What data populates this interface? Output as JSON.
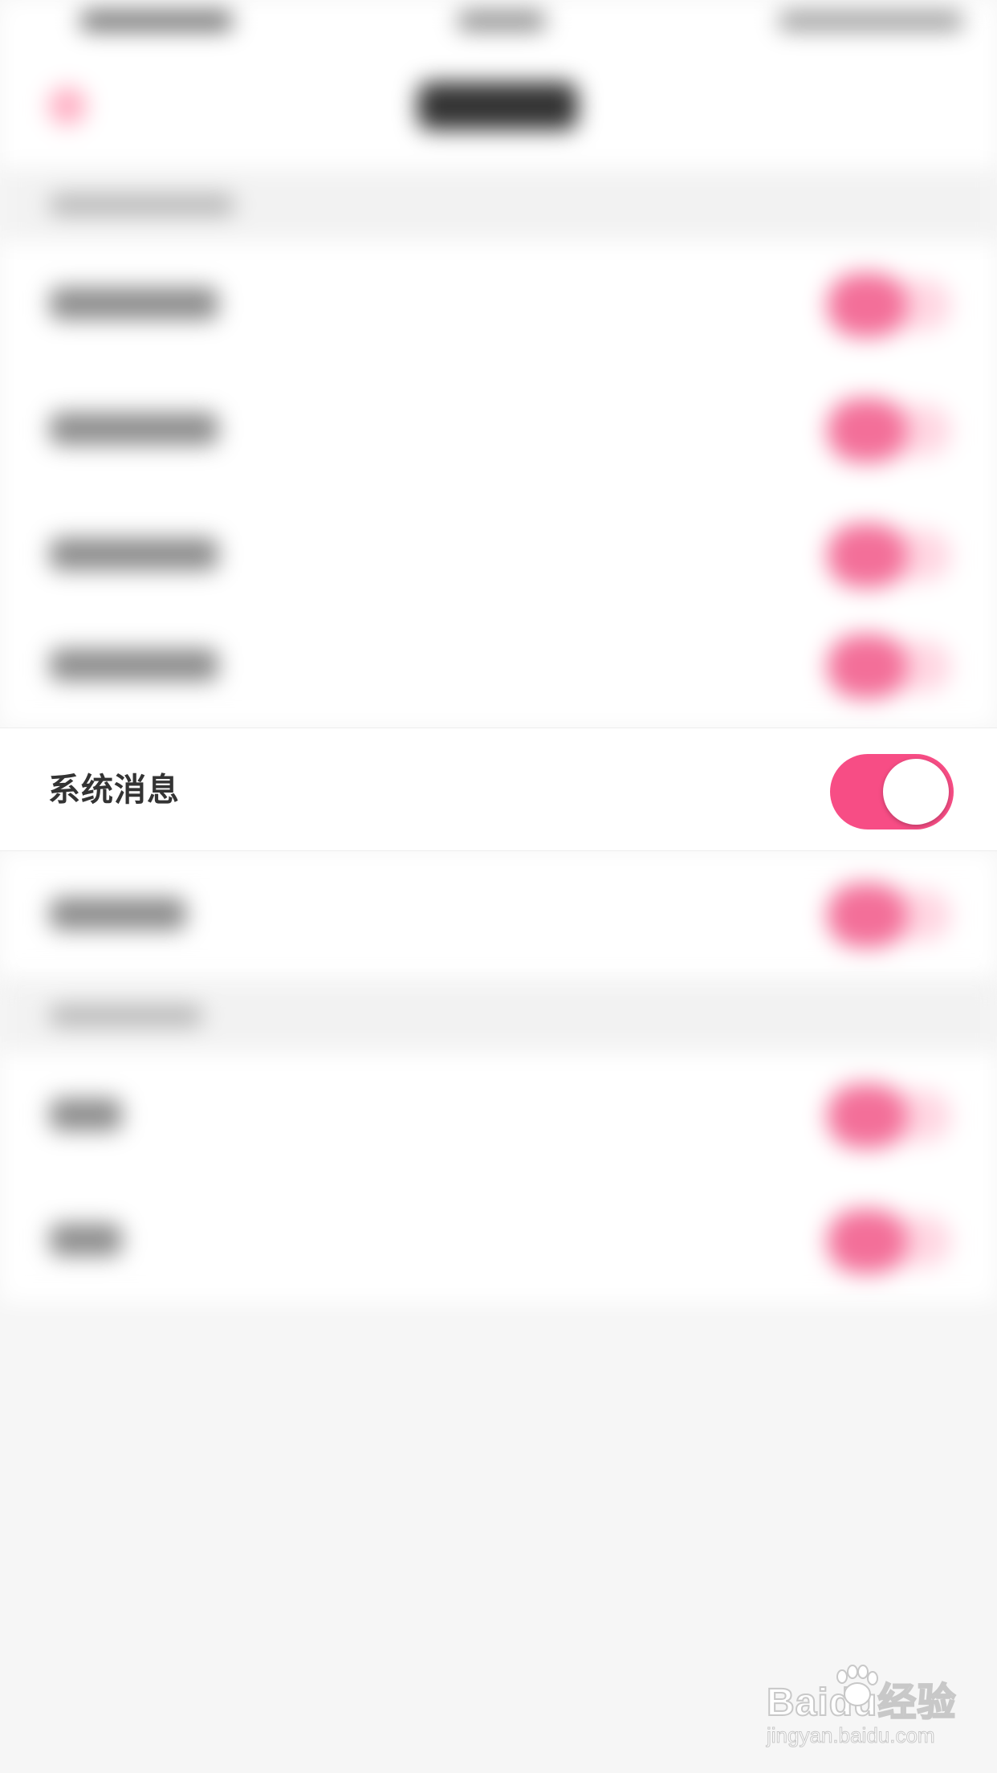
{
  "focused_setting": {
    "label": "系统消息",
    "enabled": true
  },
  "colors": {
    "accent": "#f74d85",
    "toggle_knob": "#ffffff",
    "label_text": "#333333",
    "background": "#f6f6f6",
    "row_background": "#ffffff"
  },
  "watermark": {
    "logo_text": "Baidu经验",
    "url": "jingyan.baidu.com"
  },
  "icons": {
    "back": "chevron-left-icon",
    "toggle": "toggle-switch-icon",
    "watermark_paw": "paw-icon"
  }
}
